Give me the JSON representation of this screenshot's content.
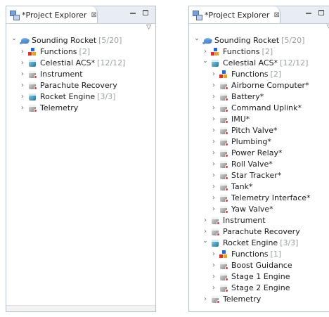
{
  "view": {
    "title": "*Project Explorer",
    "close_glyph": "⊠",
    "menu_glyph": "▽",
    "minimize_icon": "minimize-icon",
    "maximize_icon": "maximize-icon"
  },
  "left_tree": [
    {
      "label": "Sounding Rocket",
      "count": "[5/20]",
      "level": 0,
      "expanded": true,
      "icon": "rocket"
    },
    {
      "label": "Functions",
      "count": "[2]",
      "level": 1,
      "expanded": false,
      "icon": "functions"
    },
    {
      "label": "Celestial ACS*",
      "count": "[12/12]",
      "level": 1,
      "expanded": false,
      "icon": "component"
    },
    {
      "label": "Instrument",
      "count": "",
      "level": 1,
      "expanded": false,
      "icon": "component-error"
    },
    {
      "label": "Parachute Recovery",
      "count": "",
      "level": 1,
      "expanded": false,
      "icon": "component-error"
    },
    {
      "label": "Rocket Engine",
      "count": "[3/3]",
      "level": 1,
      "expanded": false,
      "icon": "component"
    },
    {
      "label": "Telemetry",
      "count": "",
      "level": 1,
      "expanded": false,
      "icon": "component-error"
    }
  ],
  "right_tree": [
    {
      "label": "Sounding Rocket",
      "count": "[5/20]",
      "level": 0,
      "expanded": true,
      "icon": "rocket"
    },
    {
      "label": "Functions",
      "count": "[2]",
      "level": 1,
      "expanded": false,
      "icon": "functions"
    },
    {
      "label": "Celestial ACS*",
      "count": "[12/12]",
      "level": 1,
      "expanded": true,
      "icon": "component"
    },
    {
      "label": "Functions",
      "count": "[2]",
      "level": 2,
      "expanded": false,
      "icon": "functions"
    },
    {
      "label": "Airborne Computer*",
      "count": "",
      "level": 2,
      "expanded": false,
      "icon": "component-error"
    },
    {
      "label": "Battery*",
      "count": "",
      "level": 2,
      "expanded": false,
      "icon": "component-error"
    },
    {
      "label": "Command Uplink*",
      "count": "",
      "level": 2,
      "expanded": false,
      "icon": "component-error"
    },
    {
      "label": "IMU*",
      "count": "",
      "level": 2,
      "expanded": false,
      "icon": "component-error"
    },
    {
      "label": "Pitch Valve*",
      "count": "",
      "level": 2,
      "expanded": false,
      "icon": "component-error"
    },
    {
      "label": "Plumbing*",
      "count": "",
      "level": 2,
      "expanded": false,
      "icon": "component-error"
    },
    {
      "label": "Power Relay*",
      "count": "",
      "level": 2,
      "expanded": false,
      "icon": "component-error"
    },
    {
      "label": "Roll Valve*",
      "count": "",
      "level": 2,
      "expanded": false,
      "icon": "component-error"
    },
    {
      "label": "Star Tracker*",
      "count": "",
      "level": 2,
      "expanded": false,
      "icon": "component-error"
    },
    {
      "label": "Tank*",
      "count": "",
      "level": 2,
      "expanded": false,
      "icon": "component-error"
    },
    {
      "label": "Telemetry Interface*",
      "count": "",
      "level": 2,
      "expanded": false,
      "icon": "component-error"
    },
    {
      "label": "Yaw Valve*",
      "count": "",
      "level": 2,
      "expanded": false,
      "icon": "component-error"
    },
    {
      "label": "Instrument",
      "count": "",
      "level": 1,
      "expanded": false,
      "icon": "component-error"
    },
    {
      "label": "Parachute Recovery",
      "count": "",
      "level": 1,
      "expanded": false,
      "icon": "component-error"
    },
    {
      "label": "Rocket Engine",
      "count": "[3/3]",
      "level": 1,
      "expanded": true,
      "icon": "component"
    },
    {
      "label": "Functions",
      "count": "[1]",
      "level": 2,
      "expanded": false,
      "icon": "functions"
    },
    {
      "label": "Boost Guidance",
      "count": "",
      "level": 2,
      "expanded": false,
      "icon": "component-error"
    },
    {
      "label": "Stage 1 Engine",
      "count": "",
      "level": 2,
      "expanded": false,
      "icon": "component-error"
    },
    {
      "label": "Stage 2 Engine",
      "count": "",
      "level": 2,
      "expanded": false,
      "icon": "component-error"
    },
    {
      "label": "Telemetry",
      "count": "",
      "level": 1,
      "expanded": false,
      "icon": "component-error"
    }
  ],
  "colors": {
    "count_text": "#9aa0a6",
    "tab_border": "#b9c3cf",
    "error_dot": "#e03a2e"
  }
}
